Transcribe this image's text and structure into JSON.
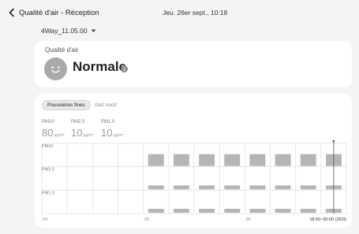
{
  "header": {
    "title": "Qualité d'air - Réception",
    "datetime": "Jeu. 26er sept., 10:18",
    "device_name": "4Way_11.05.00"
  },
  "air_quality": {
    "label": "Qualité d'air",
    "status": "Normale"
  },
  "tabs": [
    {
      "label": "Poussières fines",
      "active": true
    },
    {
      "label": "Gaz nocif",
      "active": false
    }
  ],
  "metrics": [
    {
      "name": "PM10",
      "value": "80",
      "unit": "µg/m³"
    },
    {
      "name": "PM2.5",
      "value": "10",
      "unit": "µg/m³"
    },
    {
      "name": "PM1.0",
      "value": "10",
      "unit": "µg/m³"
    }
  ],
  "chart_data": {
    "type": "bar",
    "rows": [
      "PM10",
      "PM2.5",
      "PM1.0"
    ],
    "x_tick_labels": [
      "24",
      "25",
      "26"
    ],
    "range_label": "18:00~00:00 (26/9)",
    "slots": 12,
    "first_data_slot": 4,
    "series": [
      {
        "name": "PM10",
        "levels": [
          0,
          0,
          0,
          0,
          1,
          1,
          1,
          1,
          1,
          1,
          1,
          1
        ]
      },
      {
        "name": "PM2.5",
        "levels": [
          0,
          0,
          0,
          0,
          1,
          1,
          1,
          1,
          1,
          1,
          1,
          1
        ]
      },
      {
        "name": "PM1.0",
        "levels": [
          0,
          0,
          0,
          0,
          1,
          1,
          1,
          1,
          1,
          1,
          1,
          1
        ]
      }
    ],
    "selected_slot": 11,
    "colors": {
      "bar": "#b5b5b5",
      "grid": "#e2e2e2",
      "cursor": "#555555"
    }
  },
  "icons": {
    "back": "chevron-left-icon",
    "dropdown": "caret-down-icon",
    "face": "smiley-face-icon",
    "info": "info-icon"
  }
}
